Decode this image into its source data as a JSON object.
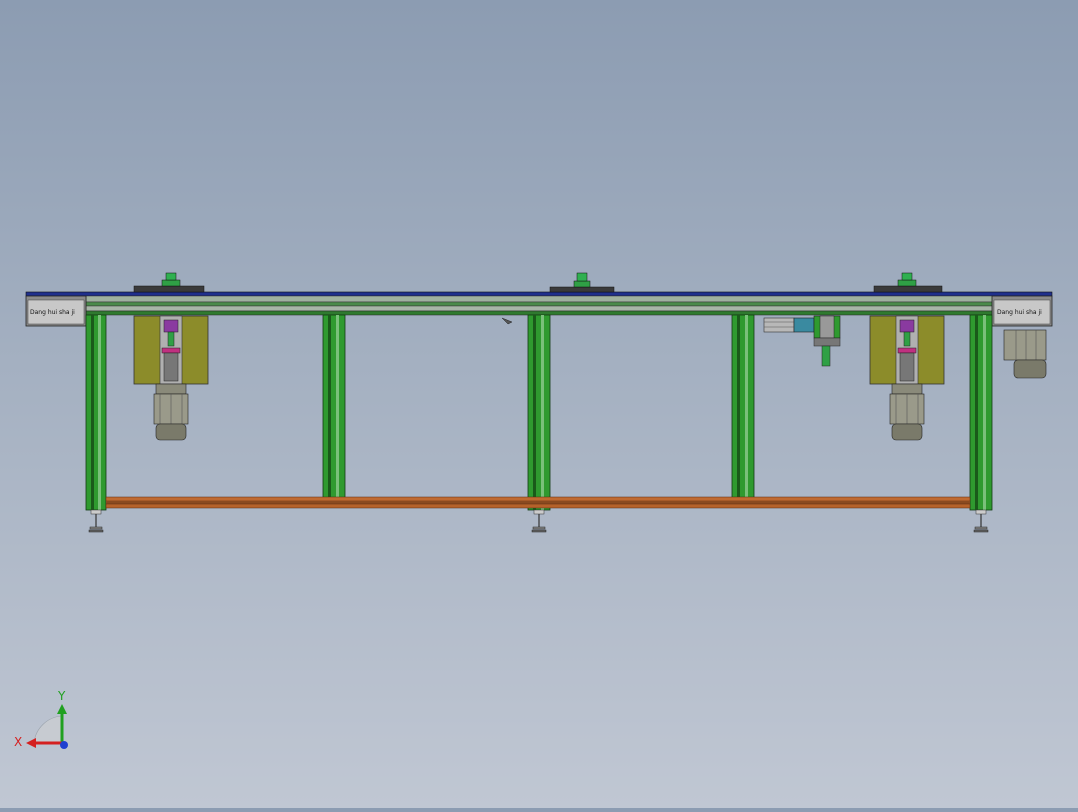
{
  "viewport": {
    "background_top": "#8c9cb2",
    "background_bottom": "#c0c7d3"
  },
  "machine": {
    "left_end_label": "Dang hui sha ji",
    "right_end_label": "Dang hui sha ji",
    "colors": {
      "frame_green": "#2f9a2f",
      "frame_dark": "#1a5a1a",
      "rail_grey": "#8a9a8a",
      "belt_blue": "#1f2f8c",
      "olive_housing": "#8c8c2a",
      "motor_grey": "#8a8a7a",
      "bottom_bar": "#b5622a",
      "end_cap": "#7a7a7a"
    }
  },
  "triad": {
    "x_label": "X",
    "y_label": "Y",
    "x_color": "#d42020",
    "y_color": "#20a020",
    "z_color": "#2040d0"
  }
}
